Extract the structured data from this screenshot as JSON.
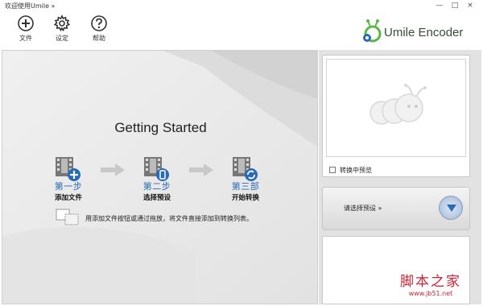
{
  "window": {
    "title": "欢迎使用Umile »",
    "minimize": "—",
    "maximize": "□",
    "close": "×"
  },
  "toolbar": {
    "file_label": "文件",
    "settings_label": "设定",
    "help_label": "帮助"
  },
  "logo": {
    "text": "Umile Encoder"
  },
  "main": {
    "heading": "Getting Started",
    "steps": [
      {
        "name": "第一步",
        "desc": "添加文件"
      },
      {
        "name": "第二步",
        "desc": "选择预设"
      },
      {
        "name": "第三部",
        "desc": "开始转换"
      }
    ],
    "hint": "用添加文件按钮或通过拖放，将文件直接添加到转换列表。"
  },
  "side": {
    "preview_checkbox_label": "转换中预览",
    "preset_label": "请选择预设 »"
  },
  "watermark": {
    "cn": "脚本之家",
    "url": "www.jb51.net"
  },
  "colors": {
    "accent_blue": "#2a6bb8",
    "logo_green": "#5ab848",
    "watermark_red": "#cc2233"
  }
}
